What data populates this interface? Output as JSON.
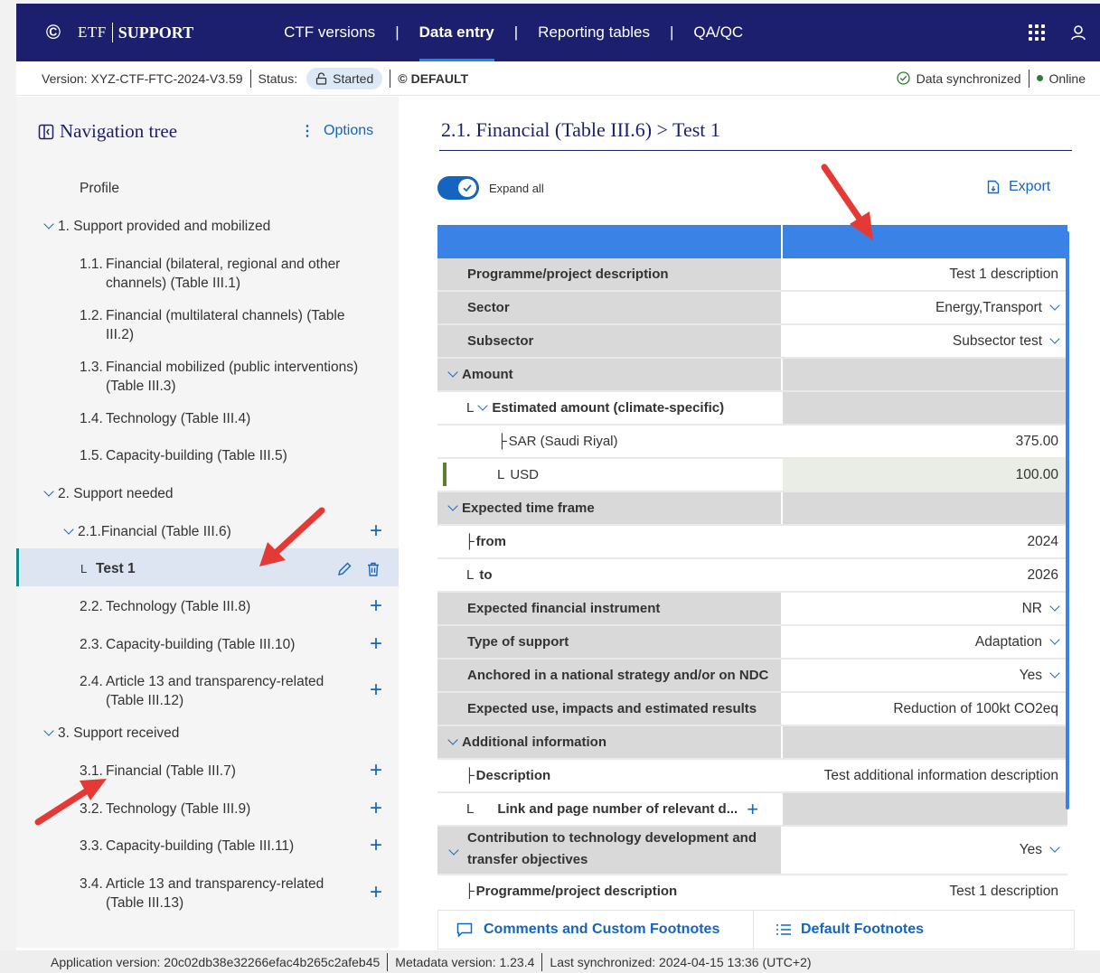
{
  "topnav": {
    "logo_etf": "ETF",
    "logo_support": "SUPPORT",
    "links": [
      "CTF versions",
      "Data entry",
      "Reporting tables",
      "QA/QC"
    ],
    "separator": "|"
  },
  "statusbar": {
    "version": "Version: XYZ-CTF-FTC-2024-V3.59",
    "status_label": "Status:",
    "status_value": "Started",
    "default_label": "DEFAULT",
    "sync": "Data synchronized",
    "online": "Online"
  },
  "navtree": {
    "title": "Navigation tree",
    "options": "Options",
    "items": [
      {
        "label": "Profile"
      },
      {
        "label": "1. Support provided and mobilized"
      },
      {
        "num": "1.1.",
        "label": "Financial (bilateral, regional and other",
        "label2": "channels) (Table III.1)"
      },
      {
        "num": "1.2.",
        "label": "Financial (multilateral channels) (Table",
        "label2": "III.2)"
      },
      {
        "num": "1.3.",
        "label": "Financial mobilized (public interventions)",
        "label2": "(Table III.3)"
      },
      {
        "num": "1.4.",
        "label": "Technology (Table III.4)"
      },
      {
        "num": "1.5.",
        "label": "Capacity-building (Table III.5)"
      },
      {
        "label": "2. Support needed"
      },
      {
        "num": "2.1.",
        "label": "Financial (Table III.6)"
      },
      {
        "label": "Test 1"
      },
      {
        "num": "2.2.",
        "label": "Technology (Table III.8)"
      },
      {
        "num": "2.3.",
        "label": "Capacity-building (Table III.10)"
      },
      {
        "num": "2.4.",
        "label": "Article 13 and transparency-related",
        "label2": "(Table III.12)"
      },
      {
        "label": "3. Support received"
      },
      {
        "num": "3.1.",
        "label": "Financial (Table III.7)"
      },
      {
        "num": "3.2.",
        "label": "Technology (Table III.9)"
      },
      {
        "num": "3.3.",
        "label": "Capacity-building (Table III.11)"
      },
      {
        "num": "3.4.",
        "label": "Article 13 and transparency-related",
        "label2": "(Table III.13)"
      }
    ]
  },
  "main": {
    "title": "2.1. Financial (Table III.6) > Test 1",
    "expand_all": "Expand all",
    "export": "Export",
    "rows": [
      {
        "label": "Programme/project description",
        "value": "Test 1 description"
      },
      {
        "label": "Sector",
        "value": "Energy,Transport"
      },
      {
        "label": "Subsector",
        "value": "Subsector test"
      },
      {
        "label": "Amount",
        "value": ""
      },
      {
        "label": "Estimated amount (climate-specific)",
        "value": ""
      },
      {
        "label": "SAR (Saudi Riyal)",
        "value": "375.00"
      },
      {
        "label": "USD",
        "value": "100.00"
      },
      {
        "label": "Expected time frame",
        "value": ""
      },
      {
        "label": "from",
        "value": "2024"
      },
      {
        "label": "to",
        "value": "2026"
      },
      {
        "label": "Expected financial instrument",
        "value": "NR"
      },
      {
        "label": "Type of support",
        "value": "Adaptation"
      },
      {
        "label": "Anchored in a national strategy and/or on NDC",
        "value": "Yes"
      },
      {
        "label": "Expected use, impacts and estimated results",
        "value": "Reduction of 100kt CO2eq"
      },
      {
        "label": "Additional information",
        "value": ""
      },
      {
        "label": "Description",
        "value": "Test additional information description"
      },
      {
        "label": "Link and page number of relevant d...",
        "value": ""
      },
      {
        "label": "Contribution to technology development and",
        "label2": "transfer objectives",
        "value": "Yes"
      },
      {
        "label": "Programme/project description",
        "value": "Test 1 description"
      }
    ],
    "tabs": [
      "Comments and Custom Footnotes",
      "Default Footnotes"
    ]
  },
  "footer": {
    "app_version": "Application version: 20c02db38e32266efac4b265c2afeb45",
    "metadata_version": "Metadata version: 1.23.4",
    "last_sync": "Last synchronized: 2024-04-15 13:36 (UTC+2)"
  },
  "colors": {
    "nav_bg": "#1c1f6e",
    "accent": "#1565c0",
    "grid_header": "#3b82e6",
    "arrow": "#e53935",
    "selected_row": "#dde5f3"
  }
}
